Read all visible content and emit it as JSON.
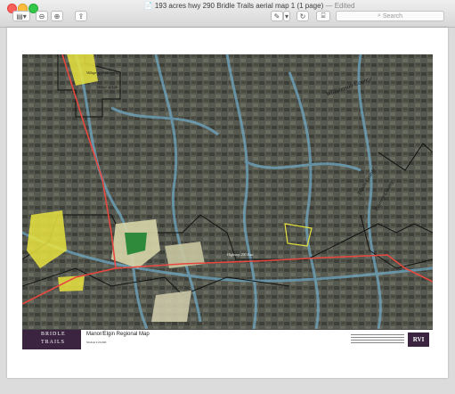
{
  "window": {
    "title": "193 acres hwy 290 Bridle Trails aerial map 1 (1 page)",
    "edited": "— Edited"
  },
  "toolbar": {
    "search_placeholder": "Search"
  },
  "map": {
    "labels": {
      "village_webberville": "Village of Webberville",
      "village_lake": "Village of Lake",
      "williamson_county": "Williamson County",
      "travis_county": "Travis County",
      "bastrop_county": "Bastrop County",
      "hwy_290": "Highway 290 East"
    },
    "colors": {
      "highway": "#e8473f",
      "boundary": "#111111",
      "parcel": "#e9e33f",
      "floodplain": "#6fa8c4"
    }
  },
  "footer": {
    "brand_line1": "BRIDLE",
    "brand_line2": "TRAILS",
    "title": "Manor/Elgin Regional Map",
    "scale_label": "SCALE 1:24,000",
    "logo_text": "RVI"
  }
}
